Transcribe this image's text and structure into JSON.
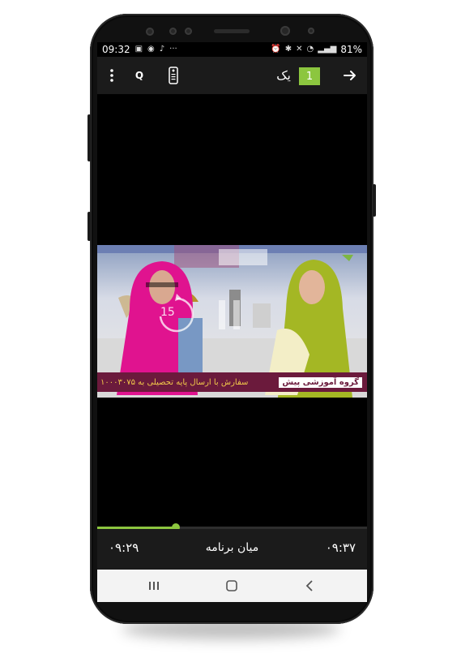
{
  "status_bar": {
    "time": "09:32",
    "battery": "81%",
    "left_icons": [
      "image-icon",
      "whatsapp-icon",
      "music-note-icon",
      "more-dots-icon"
    ],
    "right_icons": [
      "alarm-icon",
      "bluetooth-icon",
      "mute-icon",
      "wifi-icon",
      "signal-icon"
    ]
  },
  "toolbar": {
    "channel_number": "1",
    "channel_name": "یک",
    "quality_label": "Q",
    "icons": [
      "more-vertical-icon",
      "remote-icon",
      "arrow-forward-icon"
    ]
  },
  "player": {
    "rewind_label": "15",
    "ticker_text": "سفارش با ارسال پایه تحصیلی به ۱۰۰۰۳۰۷۵",
    "ticker_brand": "گروه آموزشی پیش",
    "progress_fraction": 0.29
  },
  "program": {
    "title": "میان برنامه",
    "start_time": "۰۹:۲۹",
    "end_time": "۰۹:۳۷"
  },
  "colors": {
    "accent": "#8cc63f",
    "toolbar_bg": "#1b1b1b",
    "ticker_bg": "#6b1a3c"
  }
}
